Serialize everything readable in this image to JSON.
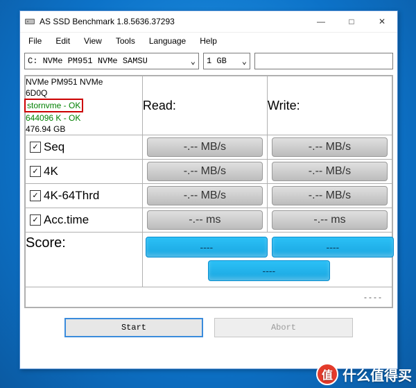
{
  "window": {
    "title": "AS SSD Benchmark 1.8.5636.37293",
    "icon_name": "ssd-icon"
  },
  "win_controls": {
    "minimize": "—",
    "maximize": "□",
    "close": "✕"
  },
  "menubar": [
    {
      "label": "File"
    },
    {
      "label": "Edit"
    },
    {
      "label": "View"
    },
    {
      "label": "Tools"
    },
    {
      "label": "Language"
    },
    {
      "label": "Help"
    }
  ],
  "toolbar": {
    "drive_combo": "C: NVMe PM951 NVMe SAMSU",
    "size_combo": "1 GB",
    "chevron_glyph": "⌄"
  },
  "device": {
    "name_line1": "NVMe PM951 NVMe",
    "name_line2": "6D0Q",
    "highlighted": "stornvme - OK",
    "alignment": "644096 K - OK",
    "capacity": "476.94 GB"
  },
  "columns": {
    "read": "Read:",
    "write": "Write:"
  },
  "rows": [
    {
      "id": "seq",
      "checked": true,
      "label": "Seq",
      "read": "-.-- MB/s",
      "write": "-.-- MB/s"
    },
    {
      "id": "4k",
      "checked": true,
      "label": "4K",
      "read": "-.-- MB/s",
      "write": "-.-- MB/s"
    },
    {
      "id": "4k64",
      "checked": true,
      "label": "4K-64Thrd",
      "read": "-.-- MB/s",
      "write": "-.-- MB/s"
    },
    {
      "id": "acc",
      "checked": true,
      "label": "Acc.time",
      "read": "-.-- ms",
      "write": "-.-- ms"
    }
  ],
  "score": {
    "label": "Score:",
    "read": "----",
    "write": "----",
    "total": "----"
  },
  "ellipsis": "----",
  "buttons": {
    "start": "Start",
    "abort": "Abort"
  },
  "watermark": {
    "badge": "值",
    "text": "什么值得买"
  }
}
